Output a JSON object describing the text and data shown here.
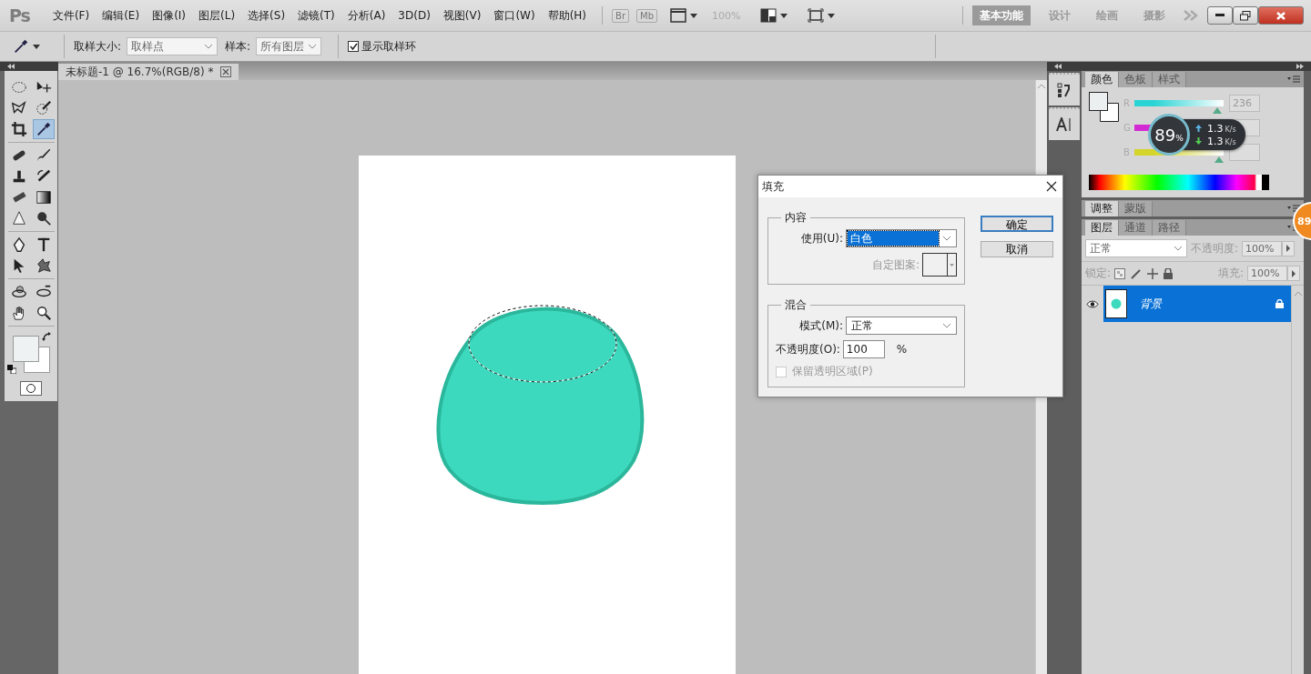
{
  "app": {
    "logo": "Ps"
  },
  "menu": [
    "文件(F)",
    "编辑(E)",
    "图像(I)",
    "图层(L)",
    "选择(S)",
    "滤镜(T)",
    "分析(A)",
    "3D(D)",
    "视图(V)",
    "窗口(W)",
    "帮助(H)"
  ],
  "bridge_buttons": [
    "Br",
    "Mb"
  ],
  "zoom": "100%",
  "workspaces": [
    {
      "label": "基本功能",
      "selected": true
    },
    {
      "label": "设计",
      "selected": false
    },
    {
      "label": "绘画",
      "selected": false
    },
    {
      "label": "摄影",
      "selected": false
    }
  ],
  "options_bar": {
    "sample_size_label": "取样大小:",
    "sample_size": "取样点",
    "sample_label": "样本:",
    "sample": "所有图层",
    "show_ring": {
      "label": "显示取样环",
      "checked": true
    }
  },
  "document_tab": {
    "title": "未标题-1 @ 16.7%(RGB/8) *"
  },
  "tool_groups": [
    [
      {
        "kind": "marquee",
        "selected": false
      },
      {
        "kind": "move",
        "selected": false
      },
      {
        "kind": "lasso",
        "selected": false
      },
      {
        "kind": "quick-select",
        "selected": false
      },
      {
        "kind": "crop",
        "selected": false
      },
      {
        "kind": "eyedropper",
        "selected": true
      }
    ],
    [
      {
        "kind": "healing",
        "selected": false
      },
      {
        "kind": "brush",
        "selected": false
      },
      {
        "kind": "stamp",
        "selected": false
      },
      {
        "kind": "history-brush",
        "selected": false
      },
      {
        "kind": "eraser",
        "selected": false
      },
      {
        "kind": "gradient",
        "selected": false
      },
      {
        "kind": "blur",
        "selected": false
      },
      {
        "kind": "dodge",
        "selected": false
      }
    ],
    [
      {
        "kind": "pen",
        "selected": false
      },
      {
        "kind": "type",
        "selected": false
      },
      {
        "kind": "path-select",
        "selected": false
      },
      {
        "kind": "custom-shape",
        "selected": false
      }
    ],
    [
      {
        "kind": "rotate-3d",
        "selected": false
      },
      {
        "kind": "orbit-3d",
        "selected": false
      },
      {
        "kind": "hand",
        "selected": false
      },
      {
        "kind": "zoom",
        "selected": false
      }
    ]
  ],
  "color_panel": {
    "tabs": [
      {
        "label": "颜色",
        "selected": true
      },
      {
        "label": "色板",
        "selected": false
      },
      {
        "label": "样式",
        "selected": false
      }
    ],
    "channels": [
      {
        "label": "R",
        "color": "#2ad4d4",
        "level": 0.93,
        "value": "236"
      },
      {
        "label": "G",
        "color": "#d42ad4"
      },
      {
        "label": "B",
        "color": "#d4d42a",
        "level": 0.95
      }
    ]
  },
  "adjust_panel": {
    "tabs": [
      {
        "label": "调整",
        "selected": true
      },
      {
        "label": "蒙版",
        "selected": false
      }
    ]
  },
  "layers_panel": {
    "tabs": [
      {
        "label": "图层",
        "selected": true
      },
      {
        "label": "通道",
        "selected": false
      },
      {
        "label": "路径",
        "selected": false
      }
    ],
    "blend_mode": "正常",
    "opacity_label": "不透明度:",
    "opacity": "100%",
    "lock_label": "锁定:",
    "fill_label": "填充:",
    "fill": "100%",
    "layers": [
      {
        "name": "背景",
        "visible": true,
        "locked": true,
        "selected": true
      }
    ]
  },
  "fill_dialog": {
    "title": "填充",
    "content_group": {
      "title": "内容",
      "use_label": "使用(U):",
      "use": "白色",
      "pattern_label": "自定图案:",
      "pattern_disabled": true
    },
    "blend_group": {
      "title": "混合",
      "mode_label": "模式(M):",
      "mode": "正常",
      "opacity_label": "不透明度(O):",
      "opacity": "100",
      "percent": "%",
      "preserve": {
        "label": "保留透明区域(P)",
        "checked": false,
        "disabled": true
      }
    },
    "buttons": [
      {
        "label": "确定",
        "default": true
      },
      {
        "label": "取消",
        "default": false
      }
    ]
  },
  "speed_widget": {
    "percent": "89",
    "unit": "%",
    "upload": "1.3",
    "upload_unit": "K/s",
    "download": "1.3",
    "download_unit": "K/s",
    "badge": "89"
  }
}
